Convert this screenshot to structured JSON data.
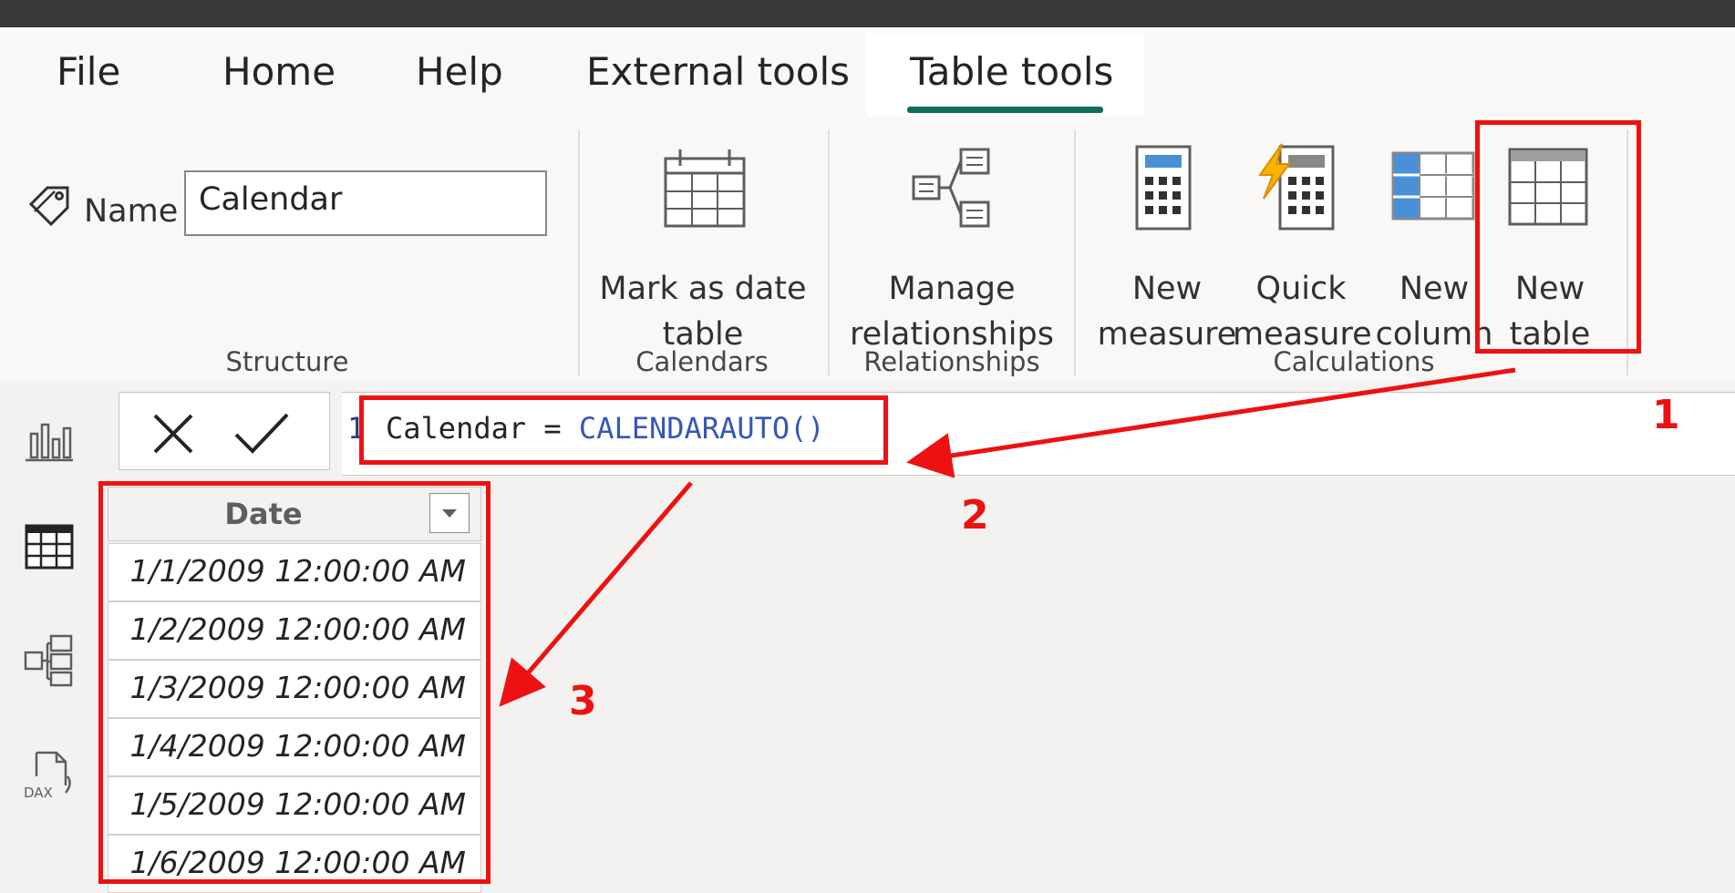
{
  "ribbon": {
    "tabs": [
      {
        "label": "File"
      },
      {
        "label": "Home"
      },
      {
        "label": "Help"
      },
      {
        "label": "External tools"
      },
      {
        "label": "Table tools"
      }
    ],
    "structure": {
      "name_label": "Name",
      "name_value": "Calendar",
      "group_label": "Structure"
    },
    "calendars": {
      "mark_date_line1": "Mark as date",
      "mark_date_line2": "table",
      "group_label": "Calendars"
    },
    "relationships": {
      "manage_line1": "Manage",
      "manage_line2": "relationships",
      "group_label": "Relationships"
    },
    "calculations": {
      "new_measure_line1": "New",
      "new_measure_line2": "measure",
      "quick_measure_line1": "Quick",
      "quick_measure_line2": "measure",
      "new_column_line1": "New",
      "new_column_line2": "column",
      "new_table_line1": "New",
      "new_table_line2": "table",
      "group_label": "Calculations"
    }
  },
  "formula_bar": {
    "line_number": "1",
    "code_ident": "Calendar = ",
    "code_fn": "CALENDARAUTO()"
  },
  "table": {
    "column_header": "Date",
    "rows": [
      "1/1/2009 12:00:00 AM",
      "1/2/2009 12:00:00 AM",
      "1/3/2009 12:00:00 AM",
      "1/4/2009 12:00:00 AM",
      "1/5/2009 12:00:00 AM",
      "1/6/2009 12:00:00 AM"
    ]
  },
  "annotations": {
    "step1": "1",
    "step2": "2",
    "step3": "3"
  },
  "colors": {
    "accent": "#0f6d5b",
    "annotation_red": "#ee1111"
  }
}
